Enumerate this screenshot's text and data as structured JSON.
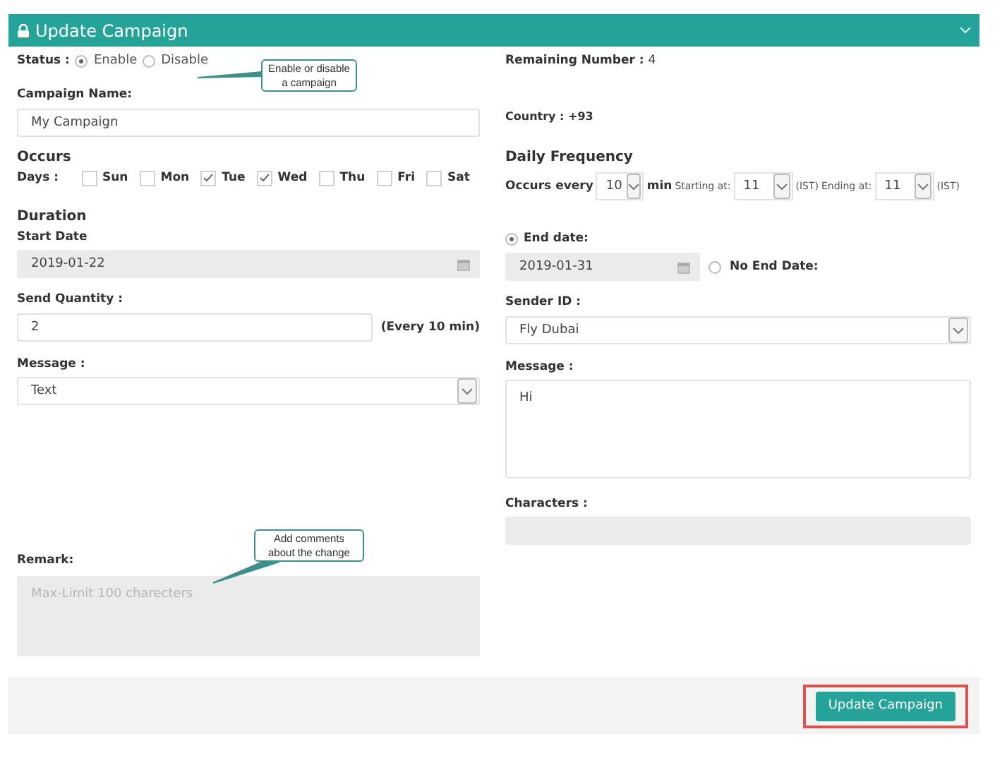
{
  "header": {
    "title": "Update Campaign"
  },
  "status": {
    "label": "Status :",
    "options": [
      {
        "label": "Enable",
        "selected": true
      },
      {
        "label": "Disable",
        "selected": false
      }
    ]
  },
  "remaining": {
    "label": "Remaining Number :",
    "value": "4"
  },
  "campaign_name": {
    "label": "Campaign Name:",
    "value": "My Campaign"
  },
  "country": {
    "label": "Country :",
    "value": "+93"
  },
  "occurs": {
    "title": "Occurs",
    "label": "Days :",
    "days": [
      {
        "label": "Sun",
        "checked": false
      },
      {
        "label": "Mon",
        "checked": false
      },
      {
        "label": "Tue",
        "checked": true
      },
      {
        "label": "Wed",
        "checked": true
      },
      {
        "label": "Thu",
        "checked": false
      },
      {
        "label": "Fri",
        "checked": false
      },
      {
        "label": "Sat",
        "checked": false
      }
    ]
  },
  "daily_frequency": {
    "title": "Daily Frequency",
    "occurs_label": "Occurs every",
    "interval": "10",
    "unit": "min",
    "start_label": "Starting at:",
    "start": "11",
    "start_zone": "(IST)",
    "end_label": "Ending at:",
    "end": "11",
    "end_zone": "(IST)"
  },
  "duration": {
    "title": "Duration",
    "start_label": "Start Date",
    "start_value": "2019-01-22"
  },
  "end": {
    "options": [
      {
        "label": "End date:",
        "selected": true
      },
      {
        "label": "No End Date:",
        "selected": false
      }
    ],
    "value": "2019-01-31"
  },
  "send_quantity": {
    "label": "Send Quantity :",
    "value": "2",
    "note": "(Every 10 min)"
  },
  "sender_id": {
    "label": "Sender ID :",
    "value": "Fly Dubai"
  },
  "message_type": {
    "label": "Message :",
    "value": "Text"
  },
  "message": {
    "label": "Message :",
    "value": "Hi"
  },
  "characters": {
    "label": "Characters :"
  },
  "remark": {
    "label": "Remark:",
    "placeholder": "Max-Limit 100 charecters"
  },
  "callouts": [
    {
      "text": "Enable or disable a campaign"
    },
    {
      "text": "Add comments about the change"
    }
  ],
  "submit": {
    "label": "Update Campaign",
    "highlighted": true
  }
}
